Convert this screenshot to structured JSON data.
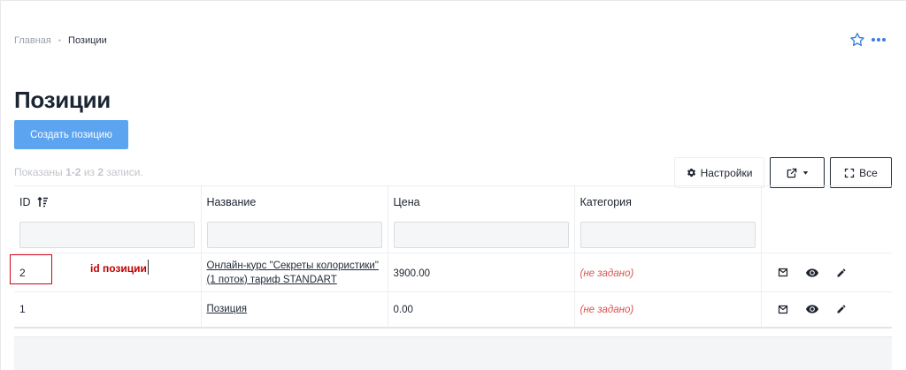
{
  "breadcrumb": {
    "home": "Главная",
    "current": "Позиции"
  },
  "page": {
    "title": "Позиции"
  },
  "toolbar": {
    "create_label": "Создать позицию",
    "settings_label": "Настройки",
    "all_label": "Все"
  },
  "summary": {
    "prefix": "Показаны",
    "range": "1-2",
    "of": "из",
    "total": "2",
    "suffix": "записи."
  },
  "table": {
    "columns": [
      "ID",
      "Название",
      "Цена",
      "Категория"
    ],
    "rows": [
      {
        "id": "2",
        "name_line1": "Онлайн-курс \"Секреты колористики\"",
        "name_line2": "(1 поток) тариф STANDART",
        "price": "3900.00",
        "category": "(не задано)"
      },
      {
        "id": "1",
        "name_line1": "Позиция",
        "name_line2": "",
        "price": "0.00",
        "category": "(не задано)"
      }
    ]
  },
  "annotation": {
    "text": "id позиции",
    "color": "#c00000"
  },
  "colors": {
    "accent": "#3b7ddd",
    "primary_button": "#5da4f0",
    "not_set": "#d9534f"
  },
  "icons": {
    "star": "star-icon",
    "more": "more-icon",
    "settings": "gear-icon",
    "export": "external-link-icon",
    "fullscreen": "fullscreen-icon",
    "sort": "sort-icon",
    "mail": "mail-icon",
    "view": "eye-icon",
    "edit": "pencil-icon"
  }
}
